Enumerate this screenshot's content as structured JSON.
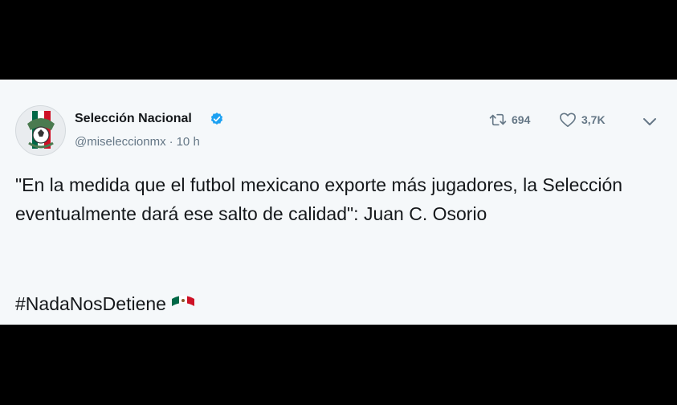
{
  "account": {
    "name": "Selección Nacional",
    "handle": "@miseleccionmx",
    "separator": "·",
    "time": "10 h",
    "verified_color": "#1da1f2"
  },
  "actions": {
    "retweet_count": "694",
    "like_count": "3,7K",
    "retweet_icon": "retweet-icon",
    "like_icon": "heart-icon",
    "more_icon": "chevron-down-icon"
  },
  "tweet": {
    "text": "\"En la medida que el futbol mexicano exporte más jugadores, la Selección eventualmente dará ese salto de calidad\": Juan C. Osorio",
    "hashtag": "#NadaNosDetiene",
    "emoji": "mexico-flag-emoji"
  },
  "colors": {
    "background": "#000000",
    "card": "#f5f8fa",
    "text": "#14171a",
    "secondary": "#657786",
    "flag_green": "#006847",
    "flag_white": "#ffffff",
    "flag_red": "#ce1126"
  }
}
